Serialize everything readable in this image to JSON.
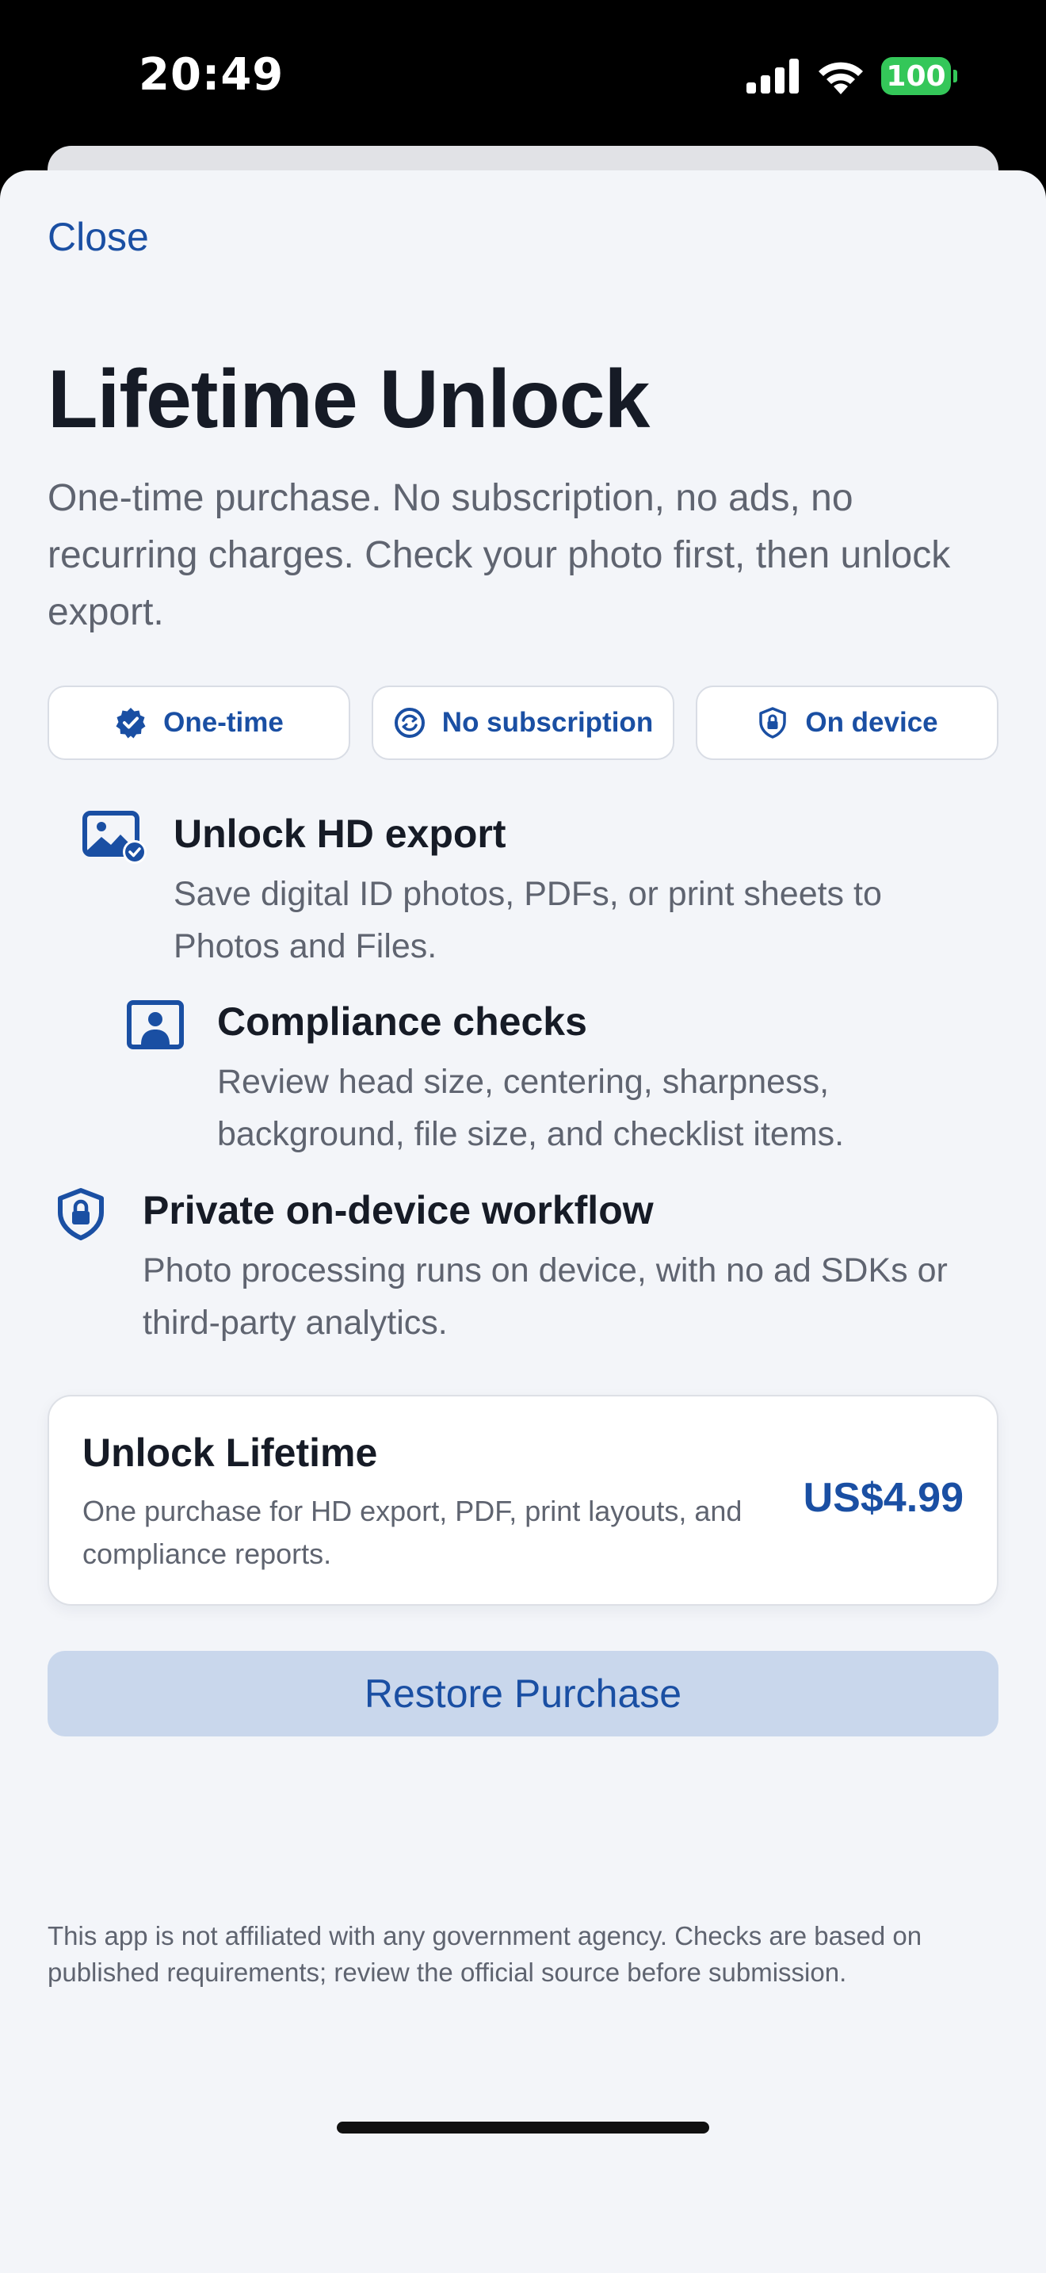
{
  "status_bar": {
    "time": "20:49",
    "battery": "100",
    "icons": [
      "signal-icon",
      "wifi-icon",
      "battery-icon"
    ]
  },
  "header": {
    "close_label": "Close",
    "title": "Lifetime Unlock",
    "subtitle": "One-time purchase. No subscription, no ads, no recurring charges. Check your photo first, then unlock export."
  },
  "chips": [
    {
      "label": "One-time",
      "icon": "verified-badge-icon"
    },
    {
      "label": "No subscription",
      "icon": "refresh-circle-icon"
    },
    {
      "label": "On device",
      "icon": "lock-shield-icon"
    }
  ],
  "features": [
    {
      "title": "Unlock HD export",
      "description": "Save digital ID photos, PDFs, or print sheets to Photos and Files.",
      "icon": "photo-check-icon"
    },
    {
      "title": "Compliance checks",
      "description": "Review head size, centering, sharpness, background, file size, and checklist items.",
      "icon": "portrait-frame-icon"
    },
    {
      "title": "Private on-device workflow",
      "description": "Photo processing runs on device, with no ad SDKs or third-party analytics.",
      "icon": "lock-shield-icon"
    }
  ],
  "purchase": {
    "title": "Unlock Lifetime",
    "description": "One purchase for HD export, PDF, print layouts, and compliance reports.",
    "price": "US$4.99"
  },
  "restore_label": "Restore Purchase",
  "disclaimer": "This app is not affiliated with any government agency. Checks are based on published requirements; review the official source before submission.",
  "colors": {
    "accent": "#1a4fa3",
    "background": "#f3f5f9",
    "restore_bg": "#c9d7ec",
    "battery": "#34c759"
  }
}
